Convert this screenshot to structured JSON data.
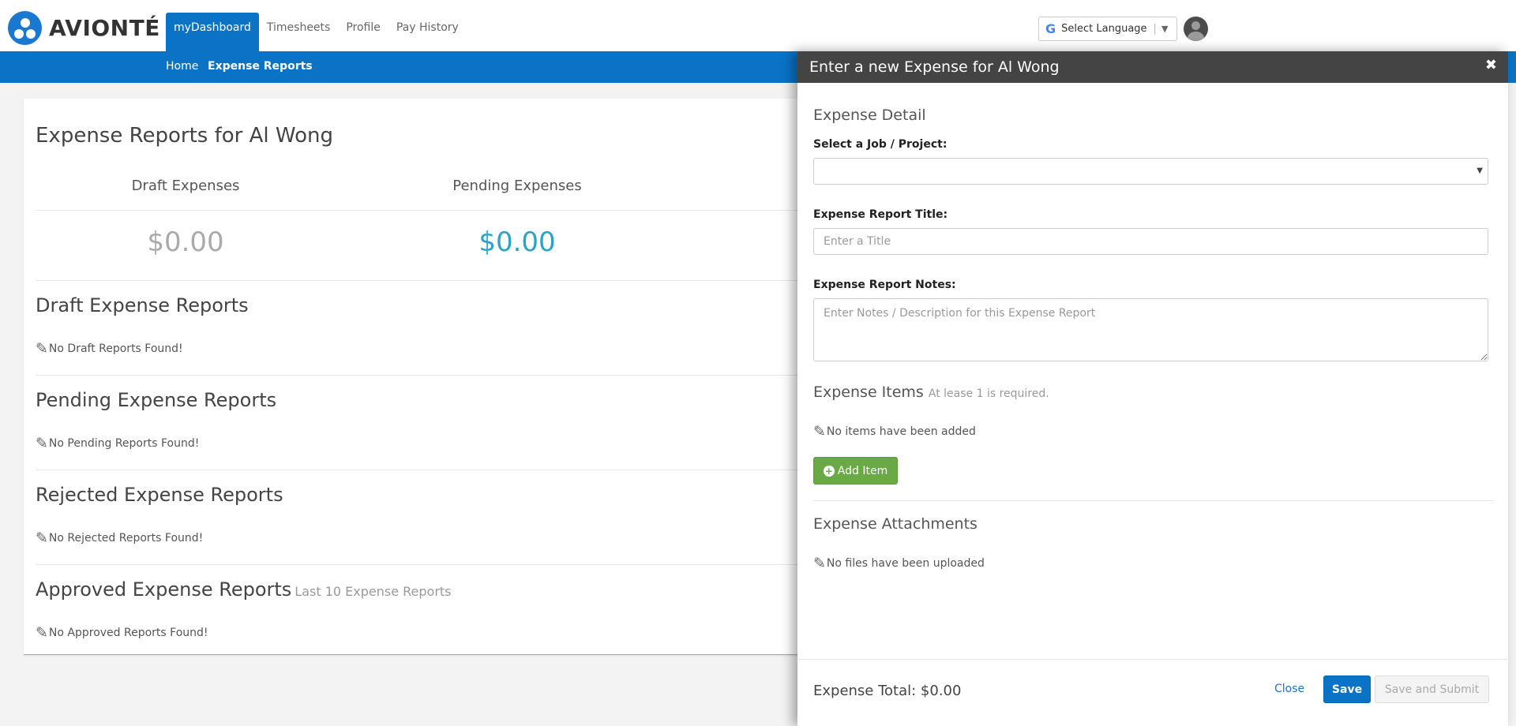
{
  "app": {
    "brand": "AVIONTÉ",
    "brand_color": "#0b73c5"
  },
  "nav": [
    {
      "label": "myDashboard",
      "active": true
    },
    {
      "label": "Timesheets",
      "active": false
    },
    {
      "label": "Profile",
      "active": false
    },
    {
      "label": "Pay History",
      "active": false
    }
  ],
  "language": {
    "label": "Select Language",
    "google_mark": "G"
  },
  "breadcrumb": [
    {
      "label": "Home"
    },
    {
      "label": "Expense Reports"
    }
  ],
  "page": {
    "title": "Expense Reports for Al Wong"
  },
  "stats": [
    {
      "label": "Draft Expenses",
      "currency": "$",
      "value": "0.00",
      "color": "#aaaaaa"
    },
    {
      "label": "Pending Expenses",
      "currency": "$",
      "value": "0.00",
      "color": "#2ba3c9"
    }
  ],
  "sections": [
    {
      "title": "Draft Expense Reports",
      "sub": "",
      "empty": "No Draft Reports Found!"
    },
    {
      "title": "Pending Expense Reports",
      "sub": "",
      "empty": "No Pending Reports Found!"
    },
    {
      "title": "Rejected Expense Reports",
      "sub": "",
      "empty": "No Rejected Reports Found!"
    },
    {
      "title": "Approved Expense Reports",
      "sub": "Last 10 Expense Reports",
      "empty": "No Approved Reports Found!"
    }
  ],
  "drawer": {
    "title": "Enter a new Expense for Al Wong",
    "close_glyph": "✖",
    "detail_heading": "Expense Detail",
    "job_label": "Select a Job / Project:",
    "job_value": "",
    "title_label": "Expense Report Title:",
    "title_placeholder": "Enter a Title",
    "notes_label": "Expense Report Notes:",
    "notes_placeholder": "Enter Notes / Description for this Expense Report",
    "items_heading": "Expense Items",
    "items_hint": "At lease 1 is required.",
    "items_empty": "No items have been added",
    "add_item_label": "Add Item",
    "attachments_heading": "Expense Attachments",
    "attachments_empty": "No files have been uploaded",
    "total_label": "Expense Total: $0.00",
    "close_label": "Close",
    "save_label": "Save",
    "submit_label": "Save and Submit"
  }
}
